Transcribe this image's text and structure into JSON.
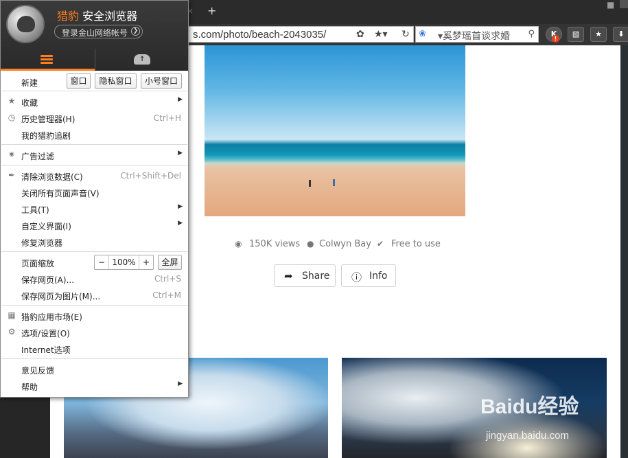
{
  "browser": {
    "url": "s.com/photo/beach-2043035/",
    "search_placeholder": "▾奚梦瑶首谈求婚",
    "new_tab_label": "+",
    "close_tab_label": "×"
  },
  "menu": {
    "brand_prefix": "猎豹",
    "brand_suffix": " 安全浏览器",
    "login_label": "登录金山网络帐号",
    "new_label": "新建",
    "new_buttons": [
      "窗口",
      "隐私窗口",
      "小号窗口"
    ],
    "items": {
      "favorites": "收藏",
      "history": "历史管理器(H)",
      "history_shortcut": "Ctrl+H",
      "follow": "我的猎豹追剧",
      "adblock": "广告过滤",
      "clear": "清除浏览数据(C)",
      "clear_shortcut": "Ctrl+Shift+Del",
      "mute": "关闭所有页面声音(V)",
      "tools": "工具(T)",
      "customize": "自定义界面(I)",
      "repair": "修复浏览器",
      "zoom": "页面缩放",
      "zoom_value": "100%",
      "fullscreen": "全屏",
      "save_page": "保存网页(A)...",
      "save_page_shortcut": "Ctrl+S",
      "save_image": "保存网页为图片(M)...",
      "save_image_shortcut": "Ctrl+M",
      "app_market": "猎豹应用市场(E)",
      "settings": "选项/设置(O)",
      "internet_options": "Internet选项",
      "feedback": "意见反馈",
      "help": "帮助"
    }
  },
  "page": {
    "views": "150K views",
    "location": "Colwyn Bay",
    "license": "Free to use",
    "share_label": "Share",
    "info_label": "Info",
    "watermark": "Baidu经验",
    "watermark_url": "jingyan.baidu.com"
  }
}
